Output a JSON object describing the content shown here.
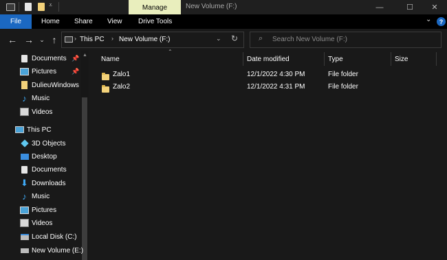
{
  "titlebar": {
    "manage_tab": "Manage",
    "window_title": "New Volume (F:)"
  },
  "ribbon": {
    "tabs": [
      "File",
      "Home",
      "Share",
      "View",
      "Drive Tools"
    ],
    "help": "?"
  },
  "nav": {
    "address": [
      "This PC",
      "New Volume (F:)"
    ],
    "search_placeholder": "Search New Volume (F:)"
  },
  "sidebar": {
    "quick_access": [
      {
        "label": "Documents",
        "icon": "documents-icon",
        "pinned": true
      },
      {
        "label": "Pictures",
        "icon": "pictures-icon",
        "pinned": true
      },
      {
        "label": "DulieuWindows",
        "icon": "folder-icon",
        "pinned": false
      },
      {
        "label": "Music",
        "icon": "music-icon",
        "pinned": false
      },
      {
        "label": "Videos",
        "icon": "videos-icon",
        "pinned": false
      }
    ],
    "this_pc": "This PC",
    "this_pc_items": [
      {
        "label": "3D Objects",
        "icon": "3d-objects-icon"
      },
      {
        "label": "Desktop",
        "icon": "desktop-icon"
      },
      {
        "label": "Documents",
        "icon": "documents-icon"
      },
      {
        "label": "Downloads",
        "icon": "downloads-icon"
      },
      {
        "label": "Music",
        "icon": "music-icon"
      },
      {
        "label": "Pictures",
        "icon": "pictures-icon"
      },
      {
        "label": "Videos",
        "icon": "videos-icon"
      },
      {
        "label": "Local Disk (C:)",
        "icon": "local-disk-icon"
      },
      {
        "label": "New Volume (E:)",
        "icon": "drive-icon"
      }
    ]
  },
  "columns": [
    "Name",
    "Date modified",
    "Type",
    "Size"
  ],
  "files": [
    {
      "name": "Zalo1",
      "date": "12/1/2022 4:30 PM",
      "type": "File folder",
      "size": ""
    },
    {
      "name": "Zalo2",
      "date": "12/1/2022 4:31 PM",
      "type": "File folder",
      "size": ""
    }
  ],
  "colors": {
    "accent": "#1b68c2",
    "manage_tab": "#e9eebd",
    "background": "#191919",
    "folder": "#f3d27a"
  }
}
